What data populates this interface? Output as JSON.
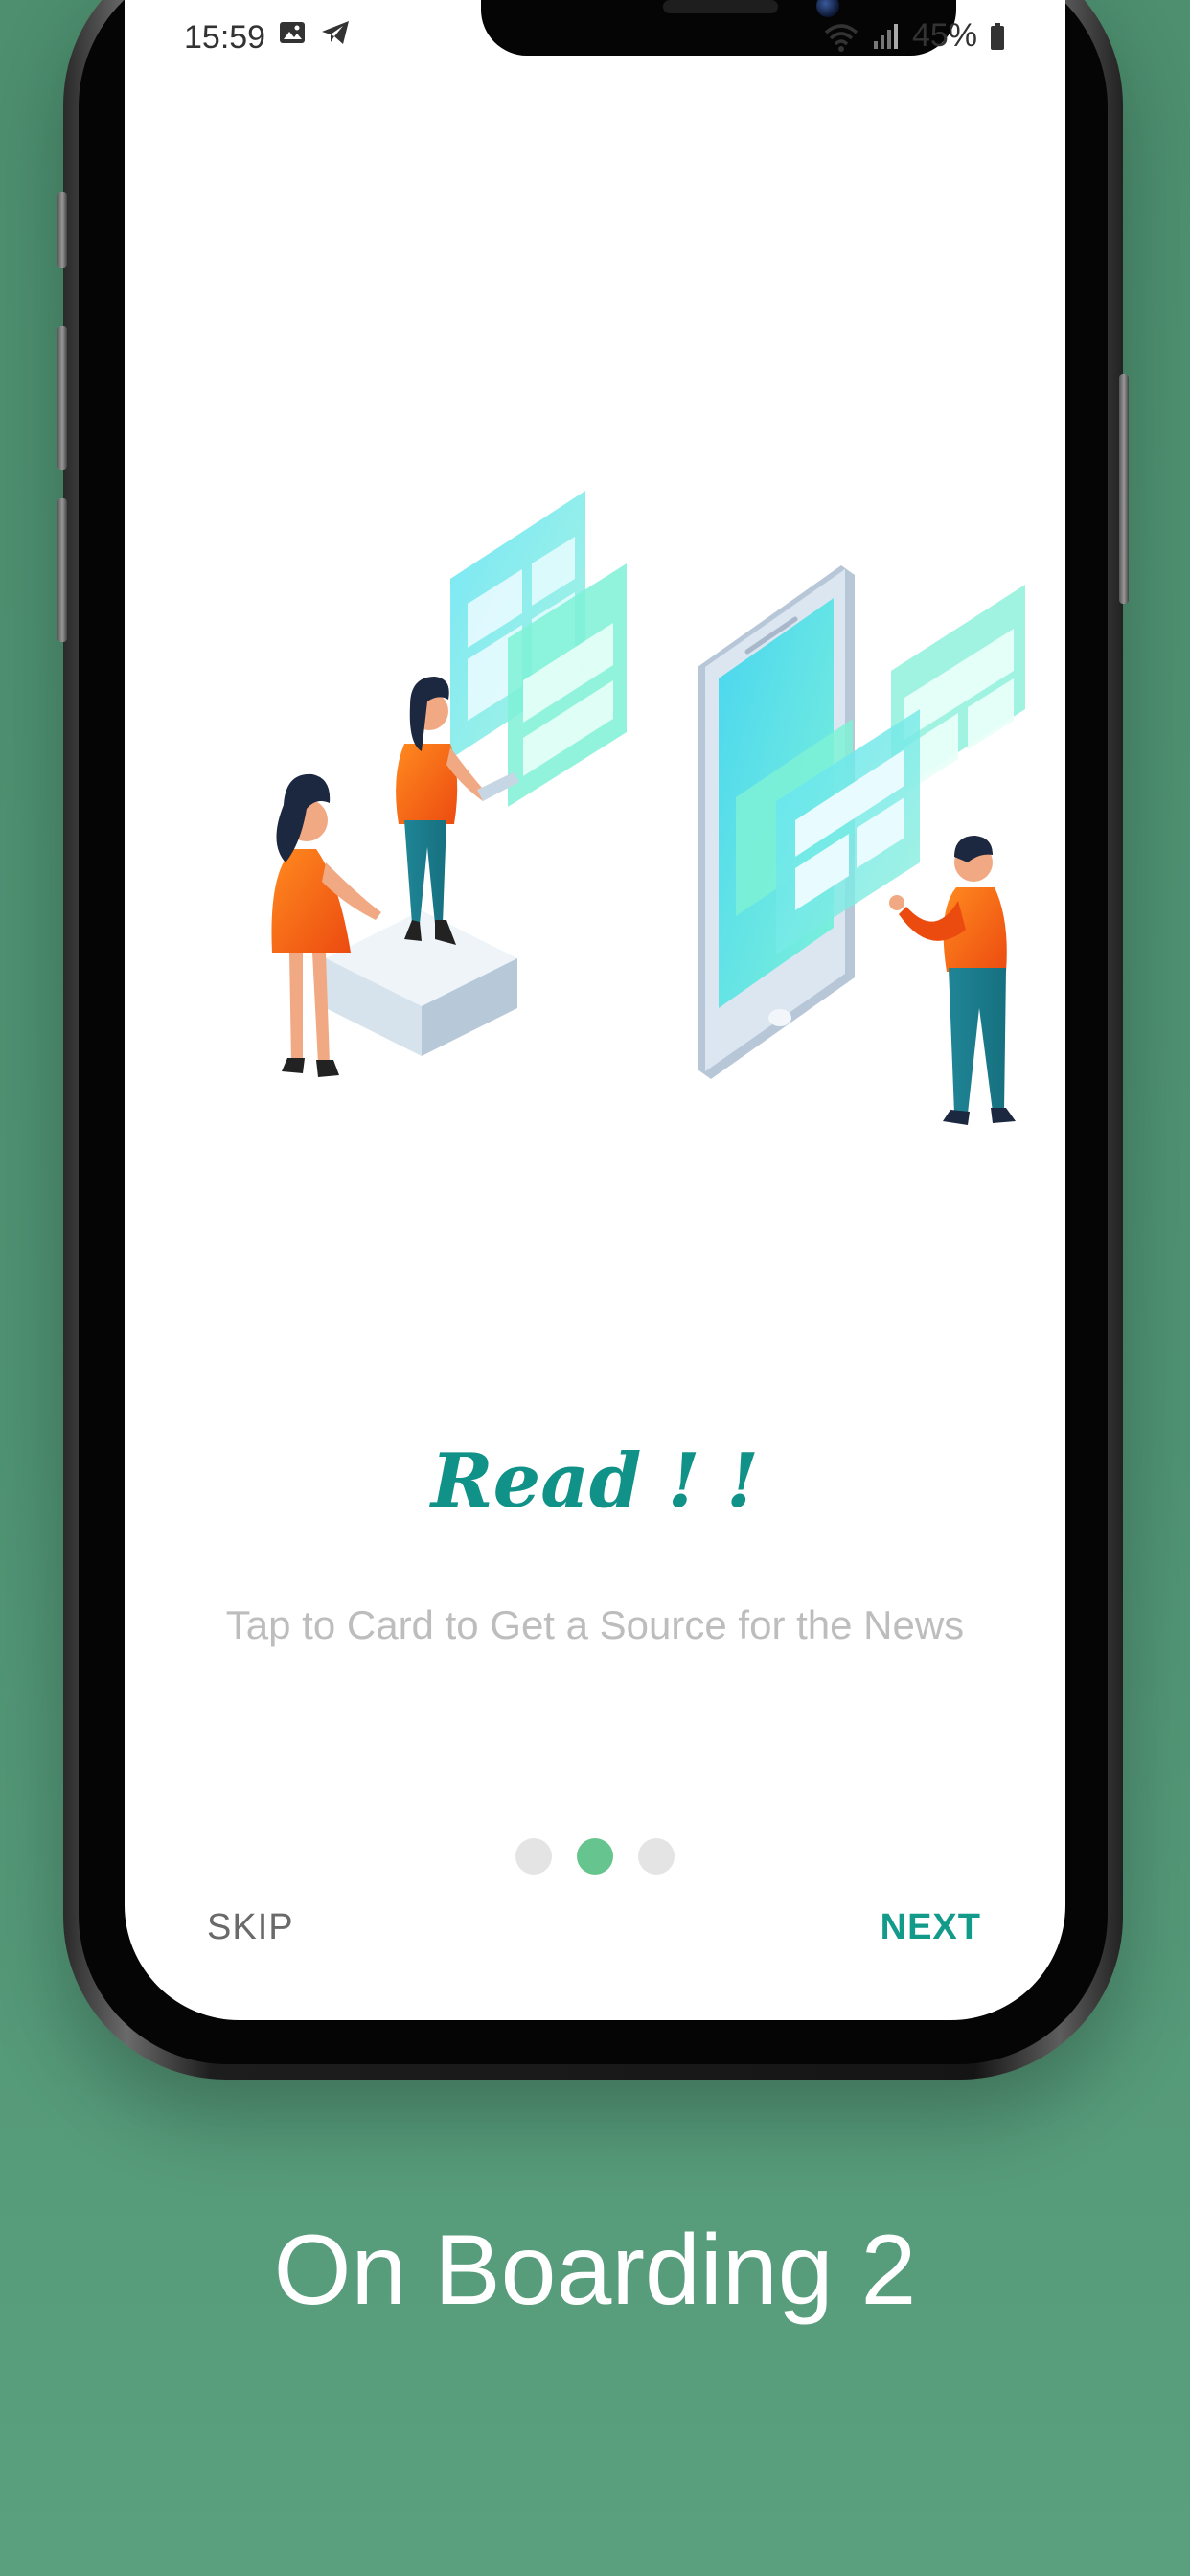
{
  "status_bar": {
    "time": "15:59",
    "battery": "45%",
    "icons": [
      "image-icon",
      "telegram-icon",
      "wifi-icon",
      "signal-icon",
      "battery-icon"
    ]
  },
  "onboarding": {
    "title": "Read ! !",
    "subtitle": "Tap to Card to Get a Source for the News",
    "pages": 3,
    "active_page": 2,
    "skip_label": "SKIP",
    "next_label": "NEXT"
  },
  "caption": "On Boarding 2",
  "colors": {
    "background": "#4f9273",
    "title": "#119288",
    "next": "#129a8a",
    "active_dot": "#66c48e",
    "inactive_dot": "#e4e4e4",
    "subtitle": "#bdbdbd"
  }
}
